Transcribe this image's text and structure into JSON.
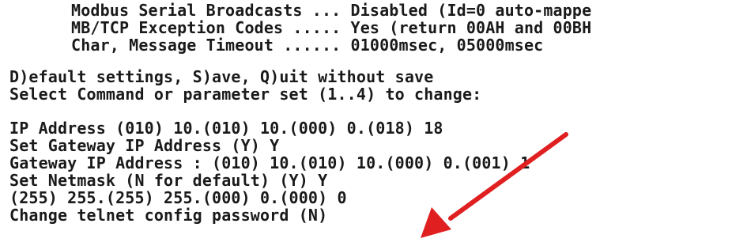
{
  "settings_block": {
    "lines": [
      "Modbus Serial Broadcasts ... Disabled (Id=0 auto-mappe",
      "MB/TCP Exception Codes ..... Yes (return 00AH and 00BH",
      "Char, Message Timeout ...... 01000msec, 05000msec"
    ]
  },
  "menu_block": {
    "lines": [
      "D)efault settings, S)ave, Q)uit without save",
      "Select Command or parameter set (1..4) to change:"
    ]
  },
  "input_block": {
    "lines": [
      "IP Address (010) 10.(010) 10.(000) 0.(018) 18",
      "Set Gateway IP Address (Y) Y",
      "Gateway IP Address : (010) 10.(010) 10.(000) 0.(001) 1",
      "Set Netmask (N for default) (Y) Y",
      "(255) 255.(255) 255.(000) 0.(000) 0",
      "Change telnet config password (N)"
    ]
  },
  "colors": {
    "background": "#ffffff",
    "text": "#1a1a1a",
    "annotation_arrow": "#e02020"
  },
  "icons": {
    "annotation": "arrow-pointer-icon"
  }
}
